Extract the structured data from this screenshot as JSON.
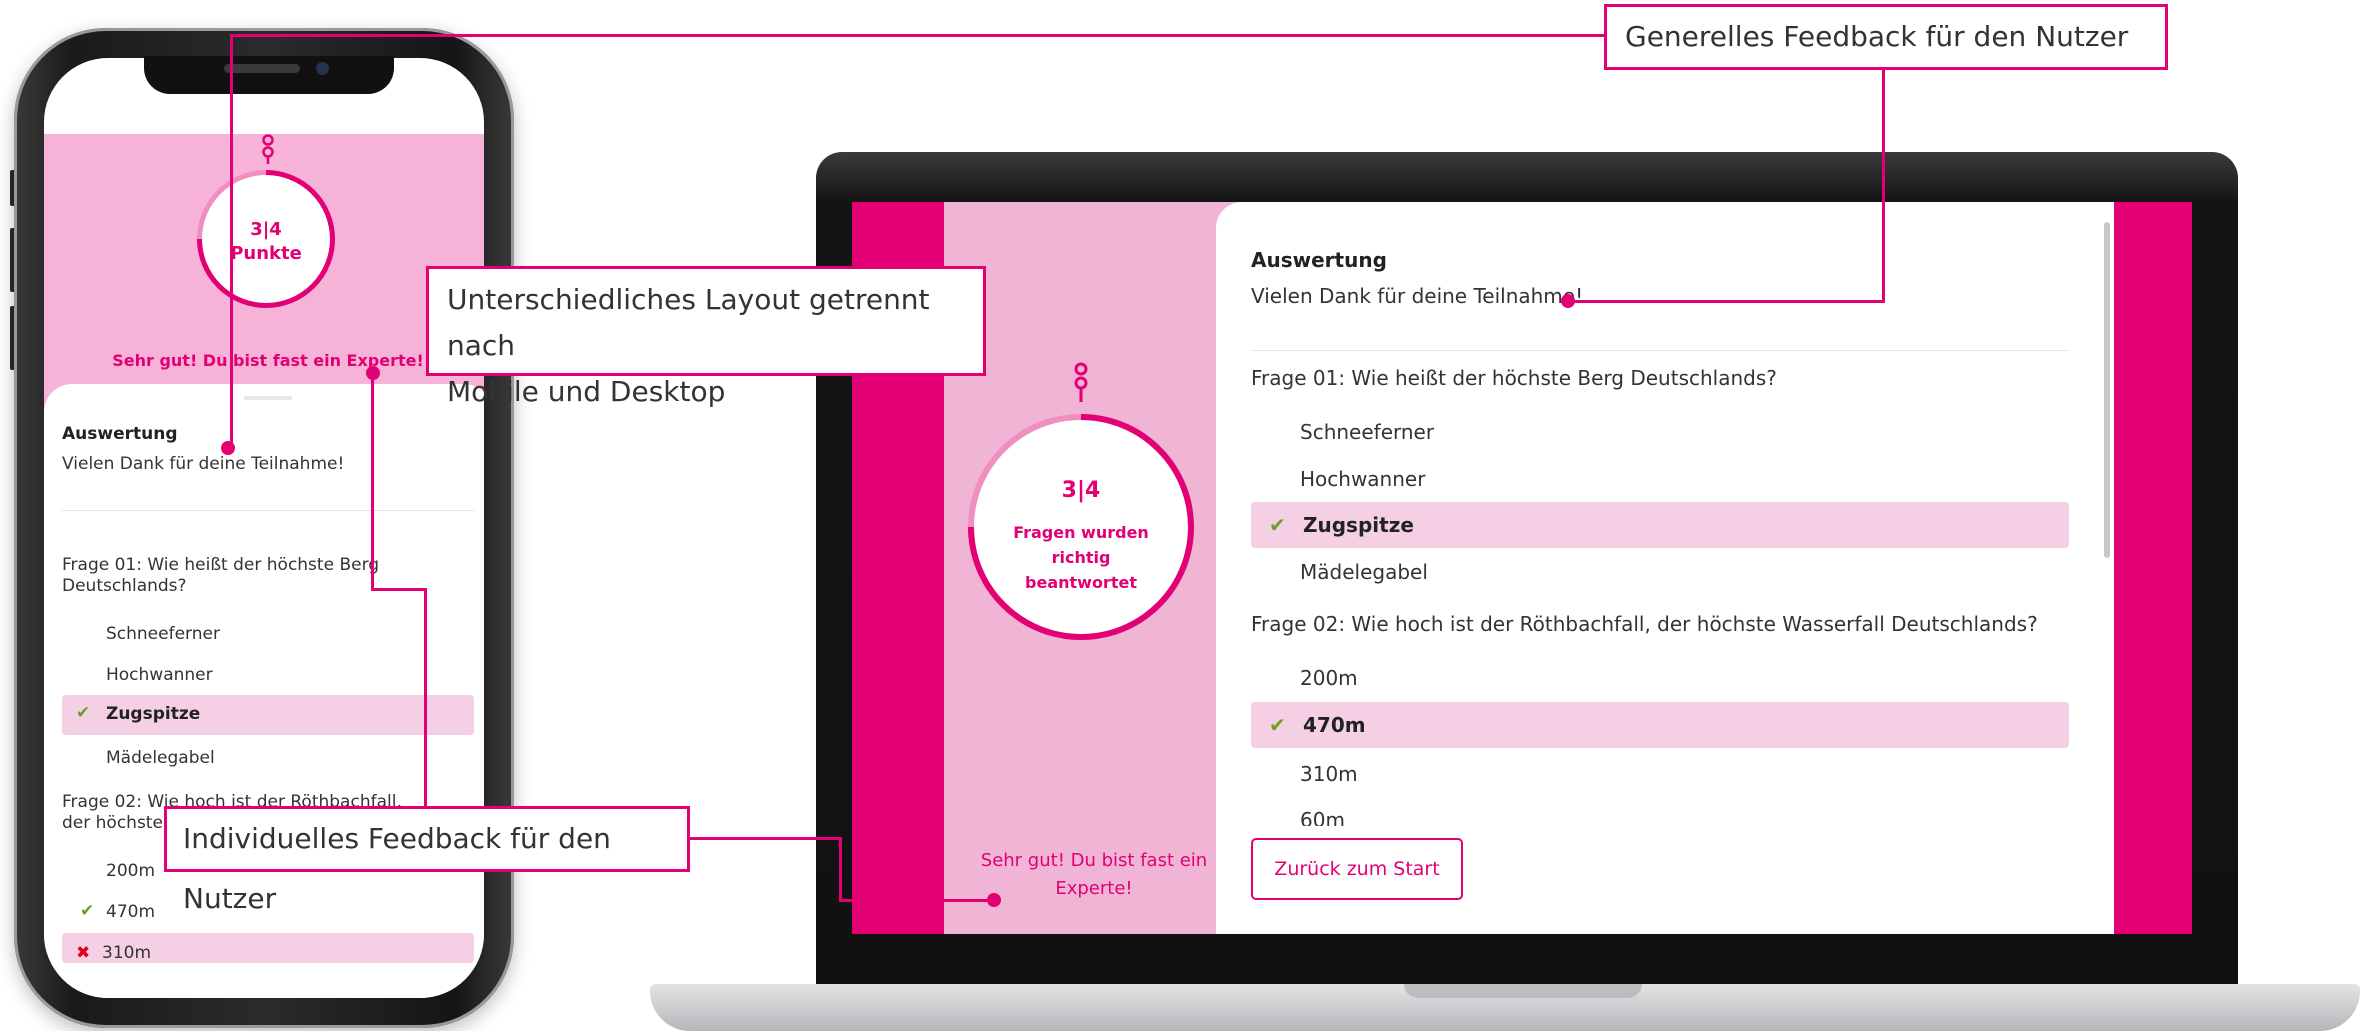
{
  "callouts": {
    "general_feedback": "Generelles Feedback für den Nutzer",
    "layout_line1": "Unterschiedliches Layout getrennt nach",
    "layout_line2": "Mobile und Desktop",
    "individual_feedback": "Individuelles Feedback für den Nutzer"
  },
  "colors": {
    "magenta": "#e20074",
    "pink_panel": "#f0b4d5",
    "highlight": "#f5cfe3",
    "correct": "#6aa02c",
    "wrong": "#e2001a"
  },
  "icons": {
    "pin": "key-pin-icon",
    "correct": "check-icon",
    "wrong": "cross-icon"
  },
  "mobile": {
    "score_value": "3|4",
    "score_label": "Punkte",
    "score_fraction": 0.75,
    "feedback": "Sehr gut! Du bist fast ein Experte!",
    "heading": "Auswertung",
    "thanks": "Vielen Dank für deine Teilnahme!",
    "q1": "Frage 01:  Wie heißt der höchste Berg Deutschlands?",
    "q1_answers": [
      "Schneeferner",
      "Hochwanner",
      "Zugspitze",
      "Mädelegabel"
    ],
    "q2": "Frage 02:  Wie hoch ist der Röthbachfall, der höchste Wasserfall Deutschlands?",
    "q2_answers": [
      "200m",
      "470m",
      "310m"
    ]
  },
  "desktop": {
    "score_value": "3|4",
    "score_label": "Fragen wurden richtig beantwortet",
    "score_fraction": 0.75,
    "feedback": "Sehr gut! Du bist fast ein Experte!",
    "heading": "Auswertung",
    "thanks": "Vielen Dank für deine Teilnahme!",
    "q1": "Frage 01:  Wie heißt der höchste Berg Deutschlands?",
    "q1_answers": [
      "Schneeferner",
      "Hochwanner",
      "Zugspitze",
      "Mädelegabel"
    ],
    "q2": "Frage 02:  Wie hoch ist der Röthbachfall, der höchste Wasserfall Deutschlands?",
    "q2_answers": [
      "200m",
      "470m",
      "310m",
      "60m"
    ],
    "back_button": "Zurück zum Start"
  }
}
